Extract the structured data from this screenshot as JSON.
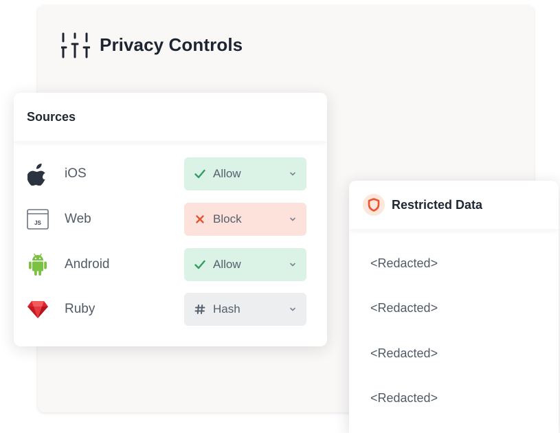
{
  "panel": {
    "title": "Privacy Controls",
    "icon": "sliders-icon"
  },
  "sources": {
    "title": "Sources",
    "rows": [
      {
        "name": "iOS",
        "icon": "apple-icon",
        "action": "Allow",
        "action_icon": "check-icon",
        "status": "allow"
      },
      {
        "name": "Web",
        "icon": "js-browser-icon",
        "icon_text": "JS",
        "action": "Block",
        "action_icon": "x-icon",
        "status": "block"
      },
      {
        "name": "Android",
        "icon": "android-icon",
        "action": "Allow",
        "action_icon": "check-icon",
        "status": "allow"
      },
      {
        "name": "Ruby",
        "icon": "ruby-gem-icon",
        "action": "Hash",
        "action_icon": "hash-icon",
        "status": "hash"
      }
    ]
  },
  "restricted": {
    "title": "Restricted Data",
    "icon": "shield-icon",
    "items": [
      "<Redacted>",
      "<Redacted>",
      "<Redacted>",
      "<Redacted>"
    ]
  },
  "colors": {
    "allow_bg": "#dbf3e7",
    "allow_fg": "#2f9e62",
    "block_bg": "#fde2dc",
    "block_fg": "#e5532f",
    "hash_bg": "#eceef0",
    "shield": "#e8552f",
    "title": "#1c2431"
  }
}
